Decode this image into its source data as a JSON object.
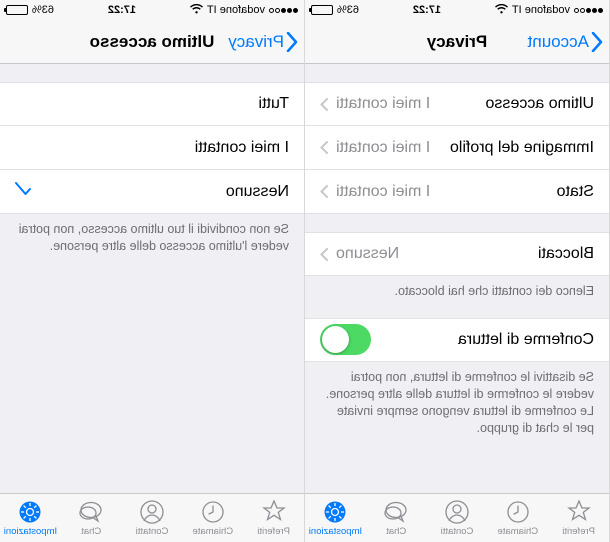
{
  "status": {
    "carrier": "vodafone IT",
    "time": "17:22",
    "battery": "63%"
  },
  "left": {
    "nav_back": "Account",
    "nav_title": "Privacy",
    "rows": {
      "last_access_label": "Ultimo accesso",
      "last_access_value": "I miei contatti",
      "profile_pic_label": "Immagine del profilo",
      "profile_pic_value": "I miei contatti",
      "status_label": "Stato",
      "status_value": "I miei contatti",
      "blocked_label": "Bloccati",
      "blocked_value": "Nessuno",
      "blocked_footer": "Elenco dei contatti che hai bloccato.",
      "read_receipt_label": "Conferme di lettura",
      "read_receipt_footer": "Se disattivi le conferme di lettura, non potrai vedere le conferme di lettura delle altre persone. Le conferme di lettura vengono sempre inviate per le chat di gruppo."
    }
  },
  "right": {
    "nav_back": "Privacy",
    "nav_title": "Ultimo accesso",
    "options": {
      "all": "Tutti",
      "contacts": "I miei contatti",
      "none": "Nessuno"
    },
    "footer": "Se non condividi il tuo ultimo accesso, non potrai vedere l'ultimo accesso delle altre persone."
  },
  "tabs": {
    "fav": "Preferiti",
    "recents": "Chiamate",
    "contacts": "Contatti",
    "chat": "Chat",
    "settings": "Impostazioni"
  }
}
